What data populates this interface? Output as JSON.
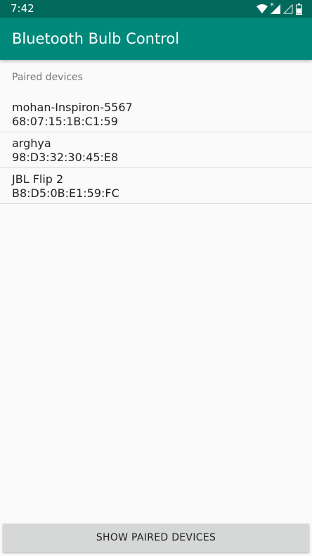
{
  "status_bar": {
    "time": "7:42",
    "icons": [
      "wifi-icon",
      "signal-icon",
      "signal-empty-icon",
      "battery-icon"
    ],
    "signal_badge": "R"
  },
  "app_bar": {
    "title": "Bluetooth Bulb Control"
  },
  "section": {
    "header": "Paired devices"
  },
  "devices": [
    {
      "name": "mohan-Inspiron-5567",
      "address": "68:07:15:1B:C1:59"
    },
    {
      "name": "arghya",
      "address": "98:D3:32:30:45:E8"
    },
    {
      "name": "JBL Flip 2",
      "address": "B8:D5:0B:E1:59:FC"
    }
  ],
  "actions": {
    "show_paired_label": "SHOW PAIRED DEVICES"
  },
  "colors": {
    "status_bar": "#00695c",
    "app_bar": "#00897b",
    "background": "#fafafa",
    "button": "#d6d7d7"
  }
}
